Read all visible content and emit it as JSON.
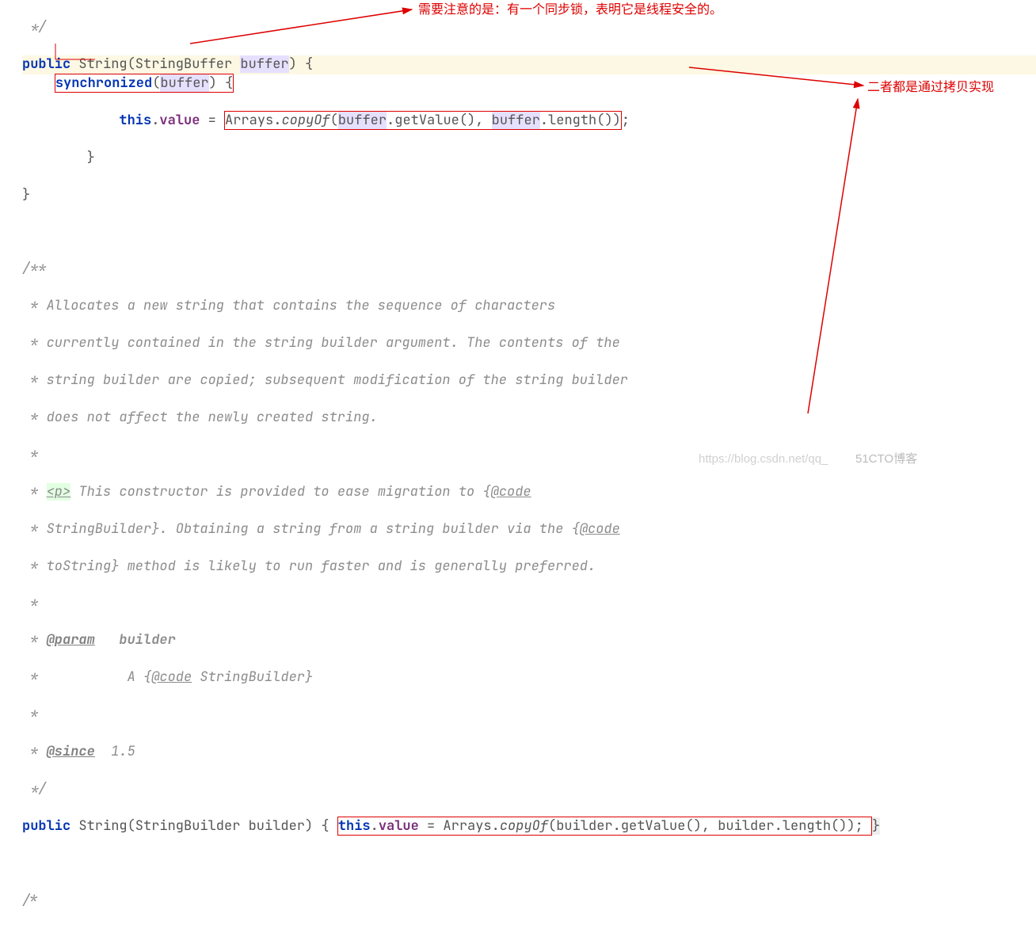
{
  "annotations": {
    "top": "需要注意的是：有一个同步锁，表明它是线程安全的。",
    "right": "二者都是通过拷贝实现"
  },
  "code": {
    "l0": " */",
    "sig1": {
      "pub": "public",
      "ret": " String(StringBuffer ",
      "param": "buffer",
      "close": ") {"
    },
    "sync": {
      "kw": "synchronized",
      "open": "(",
      "param": "buffer",
      "close": ") {"
    },
    "assign1": {
      "indent": "            ",
      "thiskw": "this",
      "dot": ".",
      "field": "value",
      "eq": " = ",
      "arr": "Arrays.",
      "m": "copyOf",
      "open": "(",
      "p1": "buffer",
      "c1": ".getValue(), ",
      "p2": "buffer",
      "c2": ".length())",
      "semi": ";"
    },
    "cb1": "        }",
    "cb2": "}",
    "jdoc": [
      "/**",
      " * Allocates a new string that contains the sequence of characters",
      " * currently contained in the string builder argument. The contents of the",
      " * string builder are copied; subsequent modification of the string builder",
      " * does not affect the newly created string.",
      " *"
    ],
    "jdoc_p": {
      "prefix": " * ",
      "tag": "<p>",
      "rest": " This constructor is provided to ease migration to {",
      "code": "@code"
    },
    "jdoc_rest": [
      " * StringBuilder}. Obtaining a string from a string builder via the {",
      " * toString} method is likely to run faster and is generally preferred.",
      " *"
    ],
    "jdoc_param": {
      "prefix": " * ",
      "tag": "@param",
      "rest": "   builder"
    },
    "jdoc_param2": {
      "prefix": " *           A {",
      "code": "@code",
      "rest": " StringBuilder}"
    },
    "jdoc_star": " *",
    "jdoc_since": {
      "prefix": " * ",
      "tag": "@since",
      "rest": "  1.5"
    },
    "jdoc_end": " */",
    "sig2": {
      "pub": "public",
      "ret": " String(StringBuilder builder) { "
    },
    "assign2": {
      "thiskw": "this",
      "dot": ".",
      "field": "value",
      "eq": " = Arrays.",
      "m": "copyOf",
      "rest": "(builder.getValue(), builder.length()); "
    },
    "sig2_close": "}",
    "trail": "/*"
  },
  "watermark": {
    "url": "https://blog.csdn.net/qq_",
    "blog": "51CTO博客"
  }
}
